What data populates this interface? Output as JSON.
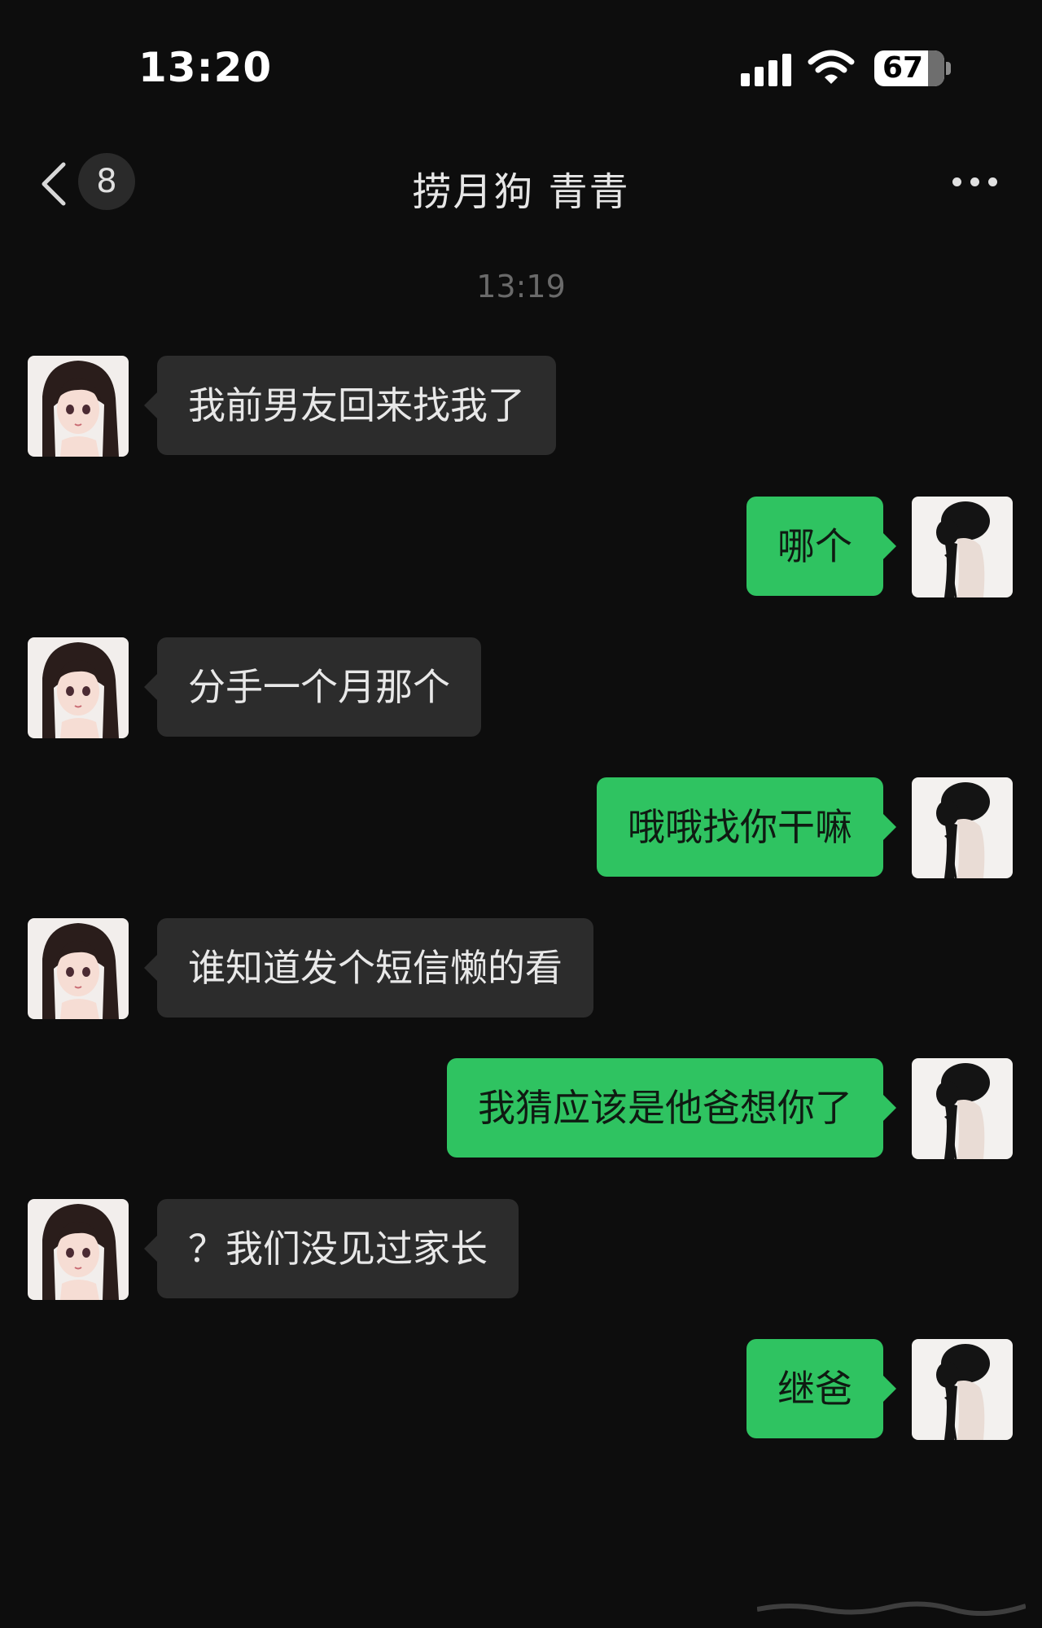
{
  "status_bar": {
    "time": "13:20",
    "battery_level": "67",
    "signal_icon": "cellular-signal-icon",
    "wifi_icon": "wifi-icon"
  },
  "nav": {
    "back_icon": "chevron-left-icon",
    "unread_count": "8",
    "title": "捞月狗  青青",
    "more_icon": "more-dots-icon"
  },
  "timestamp": "13:19",
  "messages": [
    {
      "side": "in",
      "text": "我前男友回来找我了"
    },
    {
      "side": "out",
      "text": "哪个"
    },
    {
      "side": "in",
      "text": "分手一个月那个"
    },
    {
      "side": "out",
      "text": "哦哦找你干嘛"
    },
    {
      "side": "in",
      "text": "谁知道发个短信懒的看"
    },
    {
      "side": "out",
      "text": "我猜应该是他爸想你了"
    },
    {
      "side": "in",
      "text": "？我们没见过家长"
    },
    {
      "side": "out",
      "text": "继爸"
    }
  ],
  "colors": {
    "background": "#0d0d0d",
    "incoming_bubble": "#2c2c2c",
    "outgoing_bubble": "#2fc361"
  }
}
